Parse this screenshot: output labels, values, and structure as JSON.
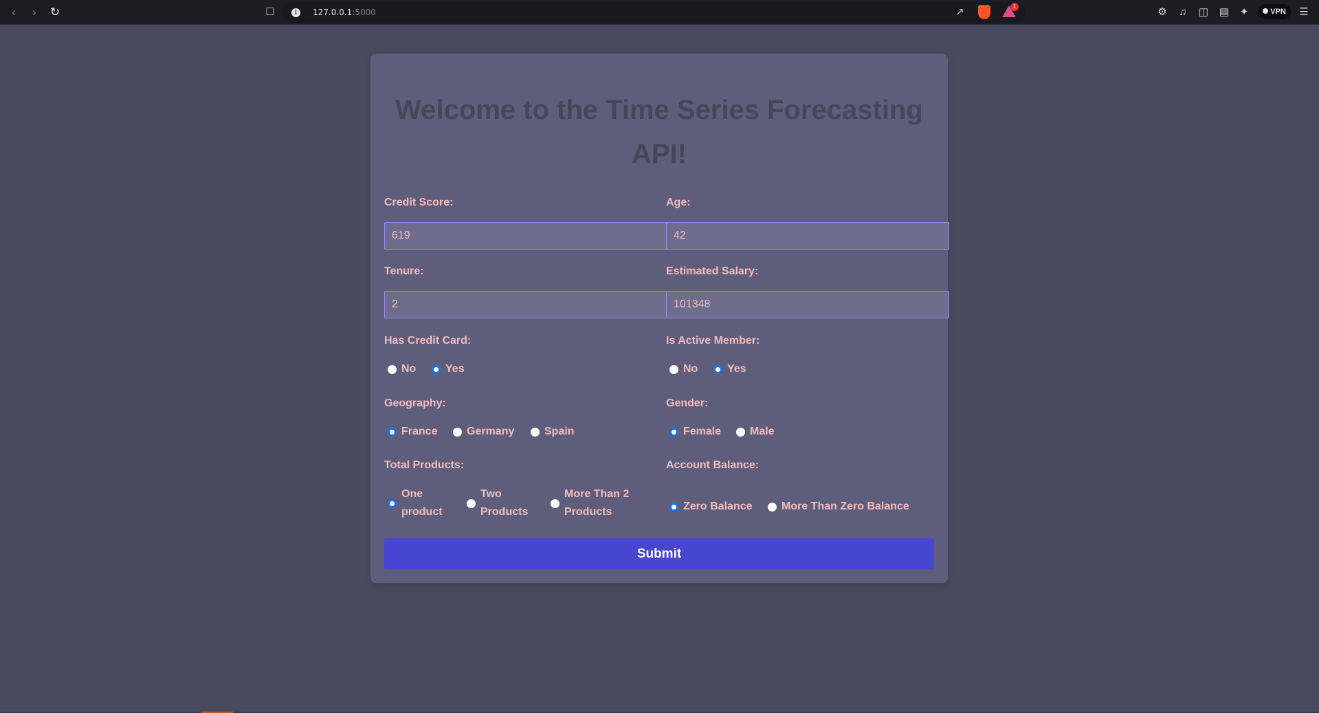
{
  "browser": {
    "url_host": "127.0.0.1",
    "url_port": ":5000",
    "vpn_label": "VPN",
    "rewards_count": "1"
  },
  "page": {
    "title_line1": "Welcome to the Time Series Forecasting",
    "title_line2": "API!"
  },
  "form": {
    "credit_score": {
      "label": "Credit Score:",
      "value": "619"
    },
    "age": {
      "label": "Age:",
      "value": "42"
    },
    "tenure": {
      "label": "Tenure:",
      "value": "2"
    },
    "estimated_salary": {
      "label": "Estimated Salary:",
      "value": "101348"
    },
    "has_credit_card": {
      "label": "Has Credit Card:",
      "options": [
        "No",
        "Yes"
      ],
      "selected": "Yes"
    },
    "is_active_member": {
      "label": "Is Active Member:",
      "options": [
        "No",
        "Yes"
      ],
      "selected": "Yes"
    },
    "geography": {
      "label": "Geography:",
      "options": [
        "France",
        "Germany",
        "Spain"
      ],
      "selected": "France"
    },
    "gender": {
      "label": "Gender:",
      "options": [
        "Female",
        "Male"
      ],
      "selected": "Female"
    },
    "total_products": {
      "label": "Total Products:",
      "options": [
        {
          "line1": "One",
          "line2": "product"
        },
        {
          "line1": "Two",
          "line2": "Products"
        },
        {
          "line1": "More Than 2",
          "line2": "Products"
        }
      ],
      "selected": "One product"
    },
    "account_balance": {
      "label": "Account Balance:",
      "options": [
        "Zero Balance",
        "More Than Zero Balance"
      ],
      "selected": "Zero Balance"
    },
    "submit_label": "Submit"
  },
  "colors": {
    "page_bg": "#4a4a5e",
    "card_bg": "#5e5d7b",
    "label_text": "#f4bcbc",
    "title_text": "#474659",
    "submit_bg": "#4646d0",
    "radio_selected": "#1a73e8"
  },
  "icons": [
    "back-icon",
    "forward-icon",
    "reload-icon",
    "bookmark-icon",
    "site-info-icon",
    "share-icon",
    "brave-shield-icon",
    "brave-rewards-icon",
    "extensions-icon",
    "media-icon",
    "sidebar-icon",
    "wallet-icon",
    "leo-ai-icon",
    "menu-icon"
  ]
}
